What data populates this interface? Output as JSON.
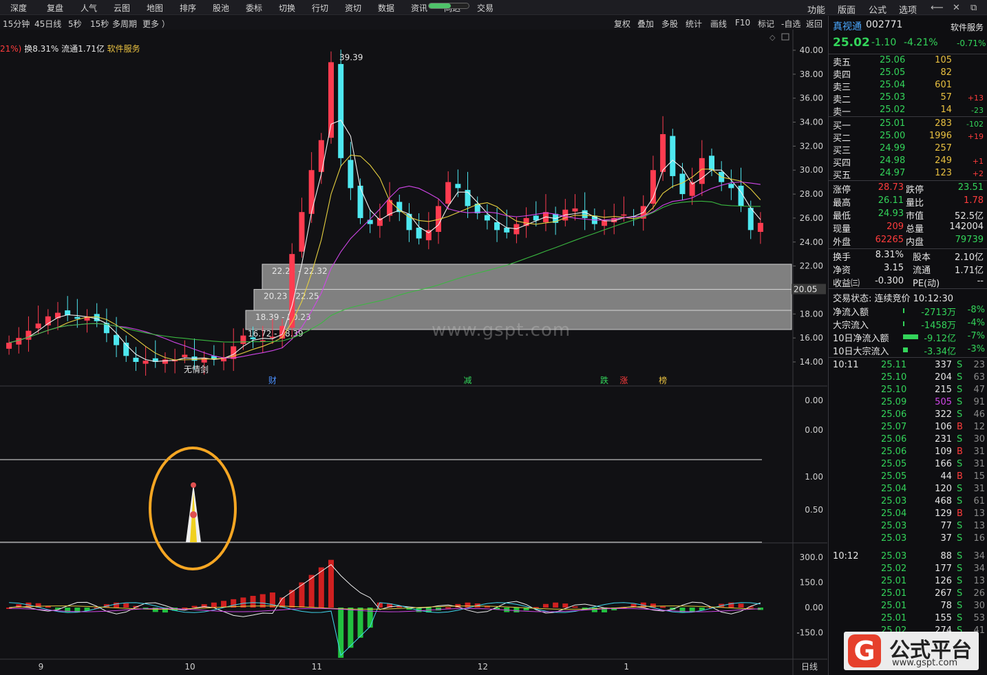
{
  "menu": {
    "left_items": [
      "深度",
      "复盘",
      "人气",
      "云图",
      "地图",
      "排序",
      "股池",
      "委标",
      "切换",
      "行切",
      "资切",
      "数据",
      "资讯",
      "同达",
      "交易"
    ],
    "right_items": [
      "功能",
      "版面",
      "公式",
      "选项"
    ],
    "progress": 0.55
  },
  "toolbar": {
    "left": [
      "15分钟",
      "45日线",
      "5秒",
      "15秒",
      "多周期",
      "更多 ）"
    ],
    "right": [
      "复权",
      "叠加",
      "多股",
      "统计",
      "画线",
      "F10",
      "标记",
      "-自选",
      "返回"
    ]
  },
  "info": {
    "prefix": "21%)",
    "text": "换8.31% 流通1.71亿",
    "industry": "软件服务"
  },
  "stock": {
    "name": "真视通",
    "code": "002771",
    "industry": "软件服务",
    "price": "25.02",
    "change": "-1.10",
    "change_pct": "-4.21%",
    "side_pct": "-0.71%"
  },
  "asks": [
    {
      "label": "卖五",
      "price": "25.06",
      "vol": "105",
      "chg": ""
    },
    {
      "label": "卖四",
      "price": "25.05",
      "vol": "82",
      "chg": ""
    },
    {
      "label": "卖三",
      "price": "25.04",
      "vol": "601",
      "chg": ""
    },
    {
      "label": "卖二",
      "price": "25.03",
      "vol": "57",
      "chg": "+13"
    },
    {
      "label": "卖一",
      "price": "25.02",
      "vol": "14",
      "chg": "-23"
    }
  ],
  "bids": [
    {
      "label": "买一",
      "price": "25.01",
      "vol": "283",
      "chg": "-102"
    },
    {
      "label": "买二",
      "price": "25.00",
      "vol": "1996",
      "chg": "+19"
    },
    {
      "label": "买三",
      "price": "24.99",
      "vol": "257",
      "chg": ""
    },
    {
      "label": "买四",
      "price": "24.98",
      "vol": "249",
      "chg": "+1"
    },
    {
      "label": "买五",
      "price": "24.97",
      "vol": "123",
      "chg": "+2"
    }
  ],
  "stats": [
    {
      "l1": "涨停",
      "v1": "28.73",
      "c1": "red",
      "l2": "跌停",
      "v2": "23.51",
      "c2": "green"
    },
    {
      "l1": "最高",
      "v1": "26.11",
      "c1": "green",
      "l2": "量比",
      "v2": "1.78",
      "c2": "red"
    },
    {
      "l1": "最低",
      "v1": "24.93",
      "c1": "green",
      "l2": "市值",
      "v2": "52.5亿",
      "c2": "white"
    },
    {
      "l1": "现量",
      "v1": "209",
      "c1": "red",
      "l2": "总量",
      "v2": "142004",
      "c2": "white"
    },
    {
      "l1": "外盘",
      "v1": "62265",
      "c1": "red",
      "l2": "内盘",
      "v2": "79739",
      "c2": "green"
    }
  ],
  "stats2": [
    {
      "l1": "换手",
      "v1": "8.31%",
      "l2": "股本",
      "v2": "2.10亿"
    },
    {
      "l1": "净资",
      "v1": "3.15",
      "l2": "流通",
      "v2": "1.71亿"
    },
    {
      "l1": "收益㈢",
      "v1": "-0.300",
      "l2": "PE(动)",
      "v2": "--"
    }
  ],
  "trade_status": "交易状态: 连续竞价 10:12:30",
  "flows": [
    {
      "label": "净流入额",
      "value": "-2713万",
      "pct": "-8%",
      "bar": 0.02
    },
    {
      "label": "大宗流入",
      "value": "-1458万",
      "pct": "-4%",
      "bar": 0.02
    },
    {
      "label": "10日净流入额",
      "value": "-9.12亿",
      "pct": "-7%",
      "bar": 1.0
    },
    {
      "label": "10日大宗流入",
      "value": "-3.34亿",
      "pct": "-3%",
      "bar": 0.3
    }
  ],
  "ticks": [
    {
      "time": "10:11",
      "price": "25.11",
      "vol": "337",
      "vc": "white",
      "bs": "S",
      "n": "23"
    },
    {
      "time": "",
      "price": "25.10",
      "vol": "204",
      "vc": "white",
      "bs": "S",
      "n": "63"
    },
    {
      "time": "",
      "price": "25.10",
      "vol": "215",
      "vc": "white",
      "bs": "S",
      "n": "47"
    },
    {
      "time": "",
      "price": "25.09",
      "vol": "505",
      "vc": "purple",
      "bs": "S",
      "n": "91"
    },
    {
      "time": "",
      "price": "25.06",
      "vol": "322",
      "vc": "white",
      "bs": "S",
      "n": "46"
    },
    {
      "time": "",
      "price": "25.07",
      "vol": "106",
      "vc": "white",
      "bs": "B",
      "n": "12"
    },
    {
      "time": "",
      "price": "25.06",
      "vol": "231",
      "vc": "white",
      "bs": "S",
      "n": "30"
    },
    {
      "time": "",
      "price": "25.06",
      "vol": "109",
      "vc": "white",
      "bs": "B",
      "n": "31"
    },
    {
      "time": "",
      "price": "25.05",
      "vol": "166",
      "vc": "white",
      "bs": "S",
      "n": "31"
    },
    {
      "time": "",
      "price": "25.05",
      "vol": "44",
      "vc": "white",
      "bs": "B",
      "n": "15"
    },
    {
      "time": "",
      "price": "25.04",
      "vol": "120",
      "vc": "white",
      "bs": "S",
      "n": "31"
    },
    {
      "time": "",
      "price": "25.03",
      "vol": "468",
      "vc": "white",
      "bs": "S",
      "n": "61"
    },
    {
      "time": "",
      "price": "25.04",
      "vol": "129",
      "vc": "white",
      "bs": "B",
      "n": "13"
    },
    {
      "time": "",
      "price": "25.03",
      "vol": "77",
      "vc": "white",
      "bs": "S",
      "n": "13"
    },
    {
      "time": "",
      "price": "25.03",
      "vol": "37",
      "vc": "white",
      "bs": "S",
      "n": "16"
    },
    {
      "time": "10:12",
      "price": "25.03",
      "vol": "88",
      "vc": "white",
      "bs": "S",
      "n": "34"
    },
    {
      "time": "",
      "price": "25.02",
      "vol": "177",
      "vc": "white",
      "bs": "S",
      "n": "34"
    },
    {
      "time": "",
      "price": "25.01",
      "vol": "126",
      "vc": "white",
      "bs": "S",
      "n": "13"
    },
    {
      "time": "",
      "price": "25.01",
      "vol": "267",
      "vc": "white",
      "bs": "S",
      "n": "26"
    },
    {
      "time": "",
      "price": "25.01",
      "vol": "78",
      "vc": "white",
      "bs": "S",
      "n": "30"
    },
    {
      "time": "",
      "price": "25.01",
      "vol": "155",
      "vc": "white",
      "bs": "S",
      "n": "53"
    },
    {
      "time": "",
      "price": "25.02",
      "vol": "274",
      "vc": "white",
      "bs": "S",
      "n": "41"
    }
  ],
  "chart": {
    "price_axis": [
      "40.00",
      "38.00",
      "36.00",
      "34.00",
      "32.00",
      "30.00",
      "28.00",
      "26.00",
      "24.00",
      "22.00",
      "20.00",
      "18.00",
      "16.00",
      "14.00"
    ],
    "price_axis_values": [
      40,
      38,
      36,
      34,
      32,
      30,
      28,
      26,
      24,
      22,
      20,
      18,
      16,
      14
    ],
    "current_price_tag": "20.05",
    "peak_label": "39.39",
    "zones": [
      {
        "label": "22.25 - 22.32",
        "low": 20.05,
        "high": 22.15
      },
      {
        "label": "20.23 - 22.25",
        "low": 18.3,
        "high": 20.05
      },
      {
        "label": "18.39 - 20.23",
        "low": 16.7,
        "high": 18.3
      }
    ],
    "zone_bottom_label": "16.72 - 18.39",
    "bottom_marker": "无情剑",
    "events": [
      {
        "label": "财",
        "color": "#4a90ff",
        "idx": 27
      },
      {
        "label": "减",
        "color": "#33d45a",
        "idx": 47
      },
      {
        "label": "跌",
        "color": "#33d45a",
        "idx": 61
      },
      {
        "label": "涨",
        "color": "#ff3c3c",
        "idx": 63
      },
      {
        "label": "榜",
        "color": "#e8c040",
        "idx": 67
      }
    ],
    "ind1_axis": [
      "0.00",
      "0.00"
    ],
    "ind2_axis": [
      "1.00",
      "0.50"
    ],
    "ind3_axis": [
      "300.0",
      "150.0",
      "0.00",
      "-150.0"
    ],
    "date_labels": [
      {
        "label": "9",
        "idx": 3
      },
      {
        "label": "10",
        "idx": 18
      },
      {
        "label": "11",
        "idx": 31
      },
      {
        "label": "12",
        "idx": 48
      },
      {
        "label": "1",
        "idx": 63
      }
    ],
    "period_label": "日线"
  },
  "watermark": "www.gspt.com",
  "logo": {
    "mark": "G",
    "title": "公式平台",
    "url": "www.gspt.com"
  }
}
